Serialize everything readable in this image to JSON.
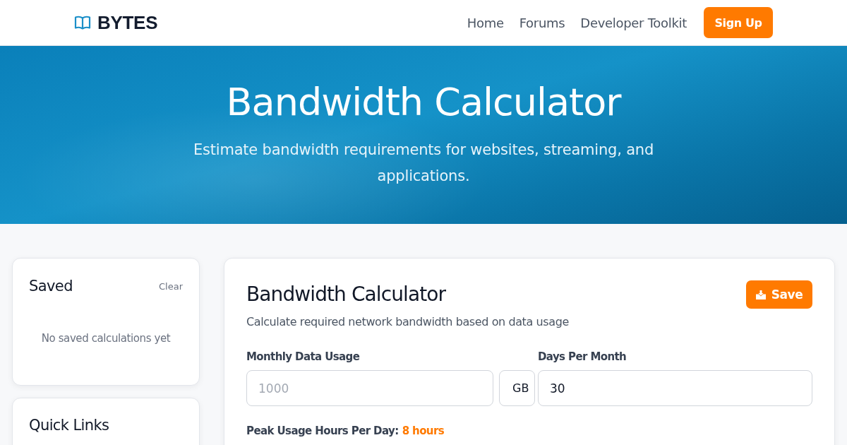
{
  "nav": {
    "brand": "BYTES",
    "links": [
      {
        "label": "Home"
      },
      {
        "label": "Forums"
      },
      {
        "label": "Developer Toolkit"
      }
    ],
    "cta": "Sign Up"
  },
  "hero": {
    "title": "Bandwidth Calculator",
    "subtitle": "Estimate bandwidth requirements for websites, streaming, and applications."
  },
  "sidebar": {
    "saved": {
      "title": "Saved",
      "action": "Clear",
      "empty_text": "No saved calculations yet"
    },
    "quick_links": {
      "title": "Quick Links"
    }
  },
  "calculator": {
    "title": "Bandwidth Calculator",
    "save_button": "Save",
    "description": "Calculate required network bandwidth based on data usage",
    "fields": [
      {
        "kind": "with-unit",
        "label": "Monthly Data Usage",
        "placeholder": "1000",
        "unit": "GB"
      },
      {
        "kind": "plain",
        "label": "Days Per Month",
        "value": "30"
      }
    ],
    "peak_hours": {
      "label": "Peak Usage Hours Per Day:",
      "value": "8 hours"
    }
  }
}
